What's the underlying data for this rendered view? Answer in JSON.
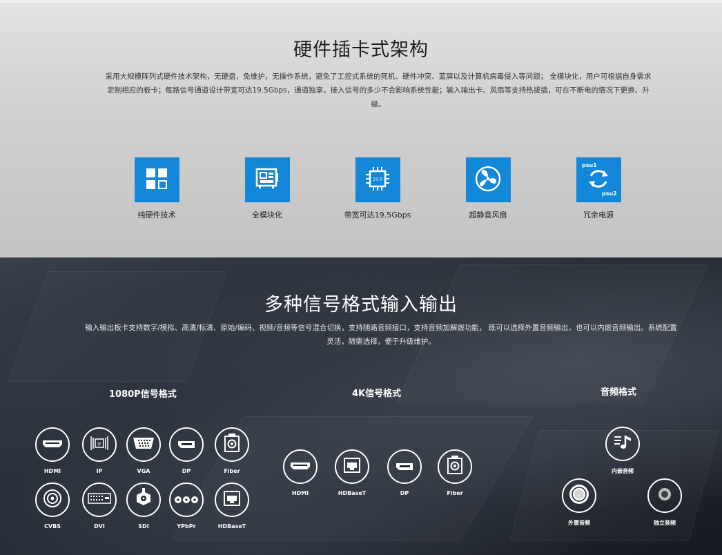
{
  "hardware": {
    "title": "硬件插卡式架构",
    "description": "采用大规模阵列式硬件技术架构，无硬盘，免维护，无操作系统，避免了工控式系统的死机、硬件冲突、蓝屏以及计算机病毒侵入等问题； 全模块化，用户可根据自身需求定制相应的板卡；每路信号通道设计带宽可达19.5Gbps，通道独享，接入信号的多少不会影响系统性能；输入输出卡、风扇等支持热拔插，可在不断电的情况下更换、升级。",
    "accent_color": "#1488d8",
    "features": [
      {
        "icon": "grid-icon",
        "label": "纯硬件技术"
      },
      {
        "icon": "module-board-icon",
        "label": "全模块化"
      },
      {
        "icon": "chip-icon",
        "chip_text": "19.5",
        "label": "带宽可达19.5Gbps"
      },
      {
        "icon": "fan-icon",
        "label": "超静音风扇"
      },
      {
        "icon": "psu-redundancy-icon",
        "psu1": "psu1",
        "psu2": "psu2",
        "label": "冗余电源"
      }
    ]
  },
  "signals": {
    "title": "多种信号格式输入输出",
    "description": "输入输出板卡支持数字/模拟、高清/标清、原始/编码、视频/音频等信号混合切换，支持随路音频接口，支持音频加解嵌功能， 既可以选择外置音频输出，也可以内嵌音频输出。系统配置灵活，随需选择，便于升级维护。",
    "groups": {
      "p1080": {
        "title": "1080P信号格式",
        "items": [
          "HDMI",
          "IP",
          "VGA",
          "DP",
          "Fiber",
          "CVBS",
          "DVI",
          "SDI",
          "YPbPr",
          "HDBaseT"
        ]
      },
      "k4": {
        "title": "4K信号格式",
        "items": [
          "HDMI",
          "HDBaseT",
          "DP",
          "Fiber"
        ]
      },
      "audio": {
        "title": "音频格式",
        "items": [
          "内嵌音频",
          "外置音频",
          "独立音频"
        ]
      }
    }
  }
}
